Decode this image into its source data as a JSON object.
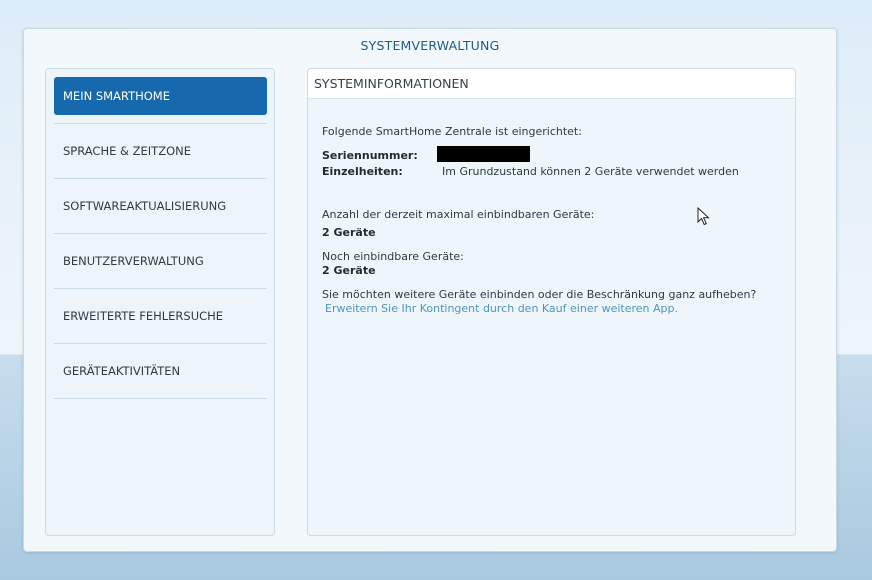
{
  "window": {
    "title": "SYSTEMVERWALTUNG"
  },
  "sidebar": {
    "items": [
      {
        "label": "MEIN SMARTHOME",
        "active": true
      },
      {
        "label": "SPRACHE & ZEITZONE",
        "active": false
      },
      {
        "label": "SOFTWAREAKTUALISIERUNG",
        "active": false
      },
      {
        "label": "BENUTZERVERWALTUNG",
        "active": false
      },
      {
        "label": "ERWEITERTE FEHLERSUCHE",
        "active": false
      },
      {
        "label": "GERÄTEAKTIVITÄTEN",
        "active": false
      }
    ]
  },
  "panel": {
    "title": "SYSTEMINFORMATIONEN",
    "intro": "Folgende SmartHome Zentrale ist eingerichtet:",
    "serial_label": "Seriennummer:",
    "details_label": "Einzelheiten:",
    "details_value": "Im Grundzustand können 2 Geräte verwendet werden",
    "max_devices_label": "Anzahl der derzeit maximal einbindbaren Geräte:",
    "max_devices_value": "2 Geräte",
    "remaining_label": "Noch einbindbare Geräte:",
    "remaining_value": "2 Geräte",
    "question": "Sie möchten weitere Geräte einbinden oder die Beschränkung ganz aufheben?",
    "link": "Erweitern Sie Ihr Kontingent durch den Kauf einer weiteren App."
  },
  "colors": {
    "accent": "#1769ad",
    "title_text": "#1e5b86",
    "link": "#4f94bd"
  }
}
